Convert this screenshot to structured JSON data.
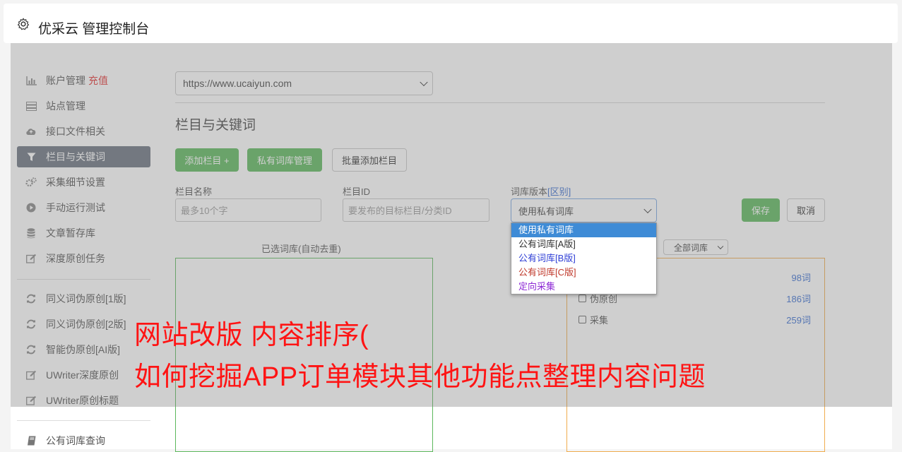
{
  "header": {
    "title": "优采云 管理控制台",
    "icon": "gear-icon"
  },
  "sidebar": {
    "items": [
      {
        "label": "账户管理",
        "extra": "充值",
        "icon": "bar-chart-icon"
      },
      {
        "label": "站点管理",
        "icon": "server-icon"
      },
      {
        "label": "接口文件相关",
        "icon": "cloud-upload-icon"
      },
      {
        "label": "栏目与关键词",
        "icon": "filter-icon",
        "active": true
      },
      {
        "label": "采集细节设置",
        "icon": "cogs-icon"
      },
      {
        "label": "手动运行测试",
        "icon": "play-circle-icon"
      },
      {
        "label": "文章暂存库",
        "icon": "database-icon"
      },
      {
        "label": "深度原创任务",
        "icon": "edit-icon"
      }
    ],
    "items2": [
      {
        "label": "同义词伪原创[1版]",
        "icon": "refresh-icon"
      },
      {
        "label": "同义词伪原创[2版]",
        "icon": "refresh-icon"
      },
      {
        "label": "智能伪原创[AI版]",
        "icon": "refresh-icon"
      },
      {
        "label": "UWriter深度原创",
        "icon": "edit-icon"
      },
      {
        "label": "UWriter原创标题",
        "icon": "edit-icon"
      }
    ],
    "items3": [
      {
        "label": "公有词库查询",
        "icon": "book-icon"
      }
    ]
  },
  "site_select": {
    "value": "https://www.ucaiyun.com"
  },
  "section": {
    "title": "栏目与关键词"
  },
  "buttons": {
    "add_column": "添加栏目 +",
    "private_lib": "私有词库管理",
    "batch_add": "批量添加栏目",
    "save": "保存",
    "cancel": "取消"
  },
  "form": {
    "name_label": "栏目名称",
    "name_placeholder": "最多10个字",
    "id_label": "栏目ID",
    "id_placeholder": "要发布的目标栏目/分类ID",
    "version_label": "词库版本",
    "version_link": "[区别]",
    "version_value": "使用私有词库"
  },
  "dropdown": {
    "options": [
      {
        "label": "使用私有词库",
        "color": "#ffffff",
        "selected": true
      },
      {
        "label": "公有词库[A版]",
        "color": "#333333"
      },
      {
        "label": "公有词库[B版]",
        "color": "#2f3fd6"
      },
      {
        "label": "公有词库[C版]",
        "color": "#c0392b"
      },
      {
        "label": "定向采集",
        "color": "#8e2bd6"
      }
    ]
  },
  "selected_panel": {
    "caption": "已选词库(自动去重)",
    "border_color": "#5cb85c"
  },
  "library_panel": {
    "filter_value": "全部词库",
    "border_color": "#f0ad4e",
    "rows": [
      {
        "label": "伪原创",
        "count": "186词"
      },
      {
        "label": "采集",
        "count": "259词"
      }
    ],
    "top_count": "98词"
  },
  "overlay_text": {
    "line1": "网站改版 内容排序(",
    "line2": "如何挖掘APP订单模块其他功能点整理内容问题"
  }
}
